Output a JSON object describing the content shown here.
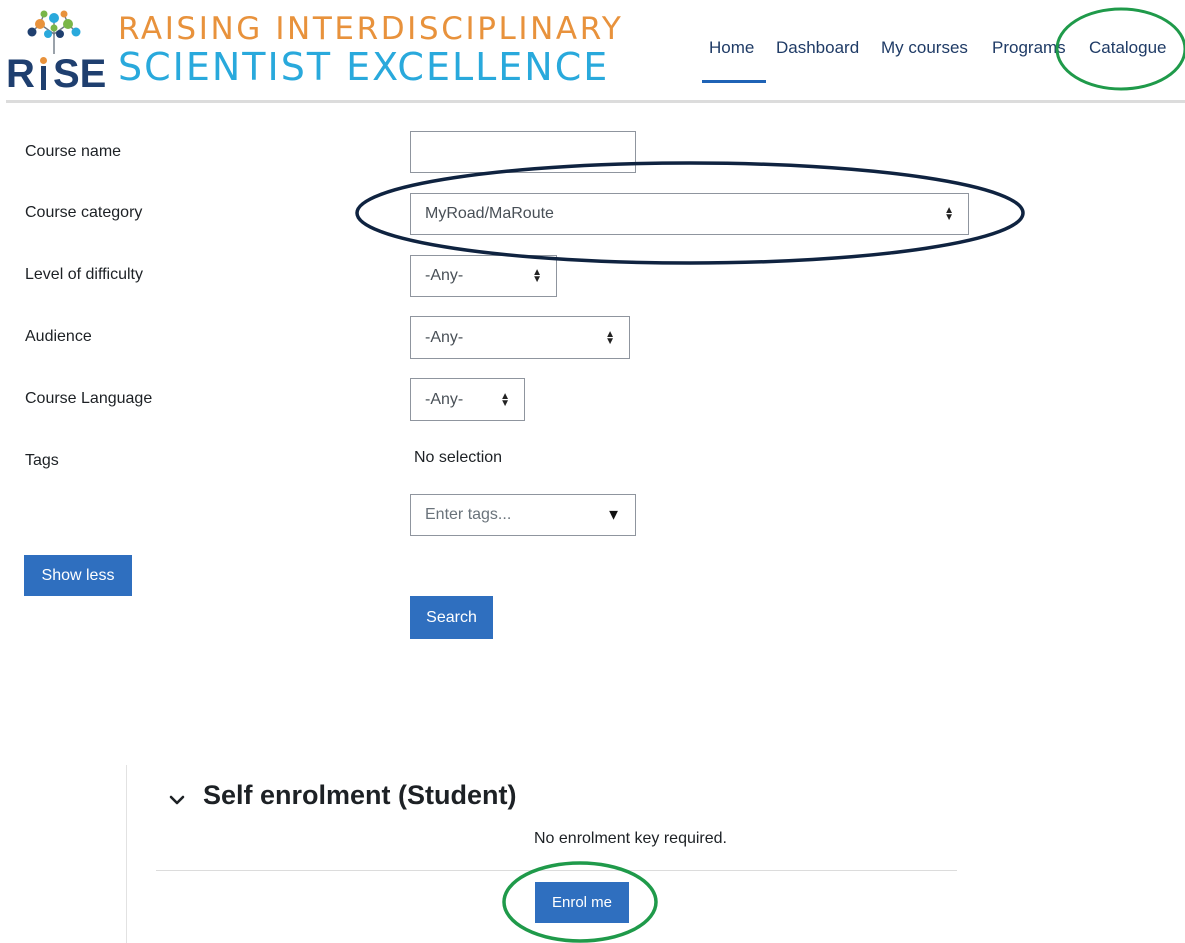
{
  "header": {
    "logo": {
      "letters_r": "R",
      "letters_se": "SE",
      "line1": "RAISING INTERDISCIPLINARY",
      "line2": "SCIENTIST EXCELLENCE",
      "colors": {
        "navy": "#1f3f6f",
        "orange": "#e8923c",
        "blue": "#29a9dc"
      }
    },
    "nav": [
      {
        "label": "Home",
        "active": true
      },
      {
        "label": "Dashboard",
        "active": false
      },
      {
        "label": "My courses",
        "active": false
      },
      {
        "label": "Programs",
        "active": false
      },
      {
        "label": "Catalogue",
        "active": false
      }
    ]
  },
  "form": {
    "course_name": {
      "label": "Course name",
      "value": ""
    },
    "course_category": {
      "label": "Course category",
      "value": "MyRoad/MaRoute"
    },
    "level_of_difficulty": {
      "label": "Level of difficulty",
      "value": "-Any-"
    },
    "audience": {
      "label": "Audience",
      "value": "-Any-"
    },
    "course_language": {
      "label": "Course Language",
      "value": "-Any-"
    },
    "tags": {
      "label": "Tags",
      "selection_text": "No selection",
      "placeholder": "Enter tags..."
    },
    "show_less_label": "Show less",
    "search_label": "Search"
  },
  "enrolment": {
    "title": "Self enrolment (Student)",
    "note": "No enrolment key required.",
    "button_label": "Enrol me"
  },
  "colors": {
    "primary_button": "#2f6fbf",
    "annotation_green": "#1f9a4a",
    "annotation_navy": "#0f2340"
  }
}
